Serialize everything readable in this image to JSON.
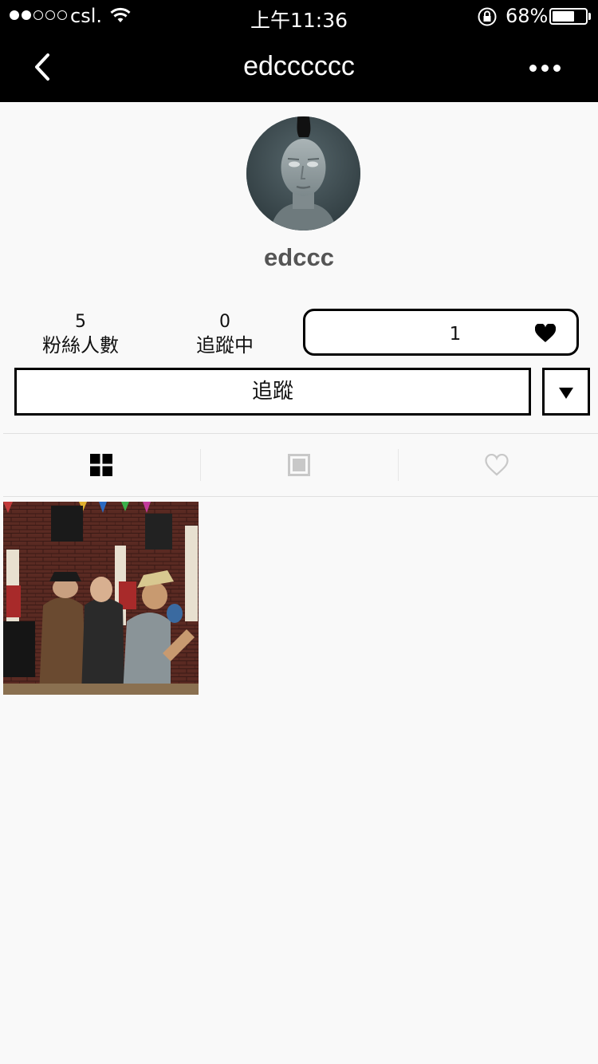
{
  "status_bar": {
    "carrier": "csl.",
    "time": "上午11:36",
    "battery_percent": "68%",
    "battery_level": 0.68,
    "signal_bars_filled": 2,
    "signal_bars_total": 5
  },
  "nav": {
    "title": "edcccccc",
    "back_icon": "chevron-left-icon",
    "more_icon": "ellipsis-icon"
  },
  "profile": {
    "username": "edccc",
    "followers_count": "5",
    "followers_label": "粉絲人數",
    "following_count": "0",
    "following_label": "追蹤中",
    "likes_count": "1",
    "follow_button_label": "追蹤"
  },
  "tabs": [
    {
      "icon": "grid-icon",
      "active": true
    },
    {
      "icon": "single-post-icon",
      "active": false
    },
    {
      "icon": "heart-outline-icon",
      "active": false
    }
  ],
  "colors": {
    "topbar_bg": "#000000",
    "page_bg": "#f9f9f9",
    "inactive_icon": "#c8c8c8"
  }
}
